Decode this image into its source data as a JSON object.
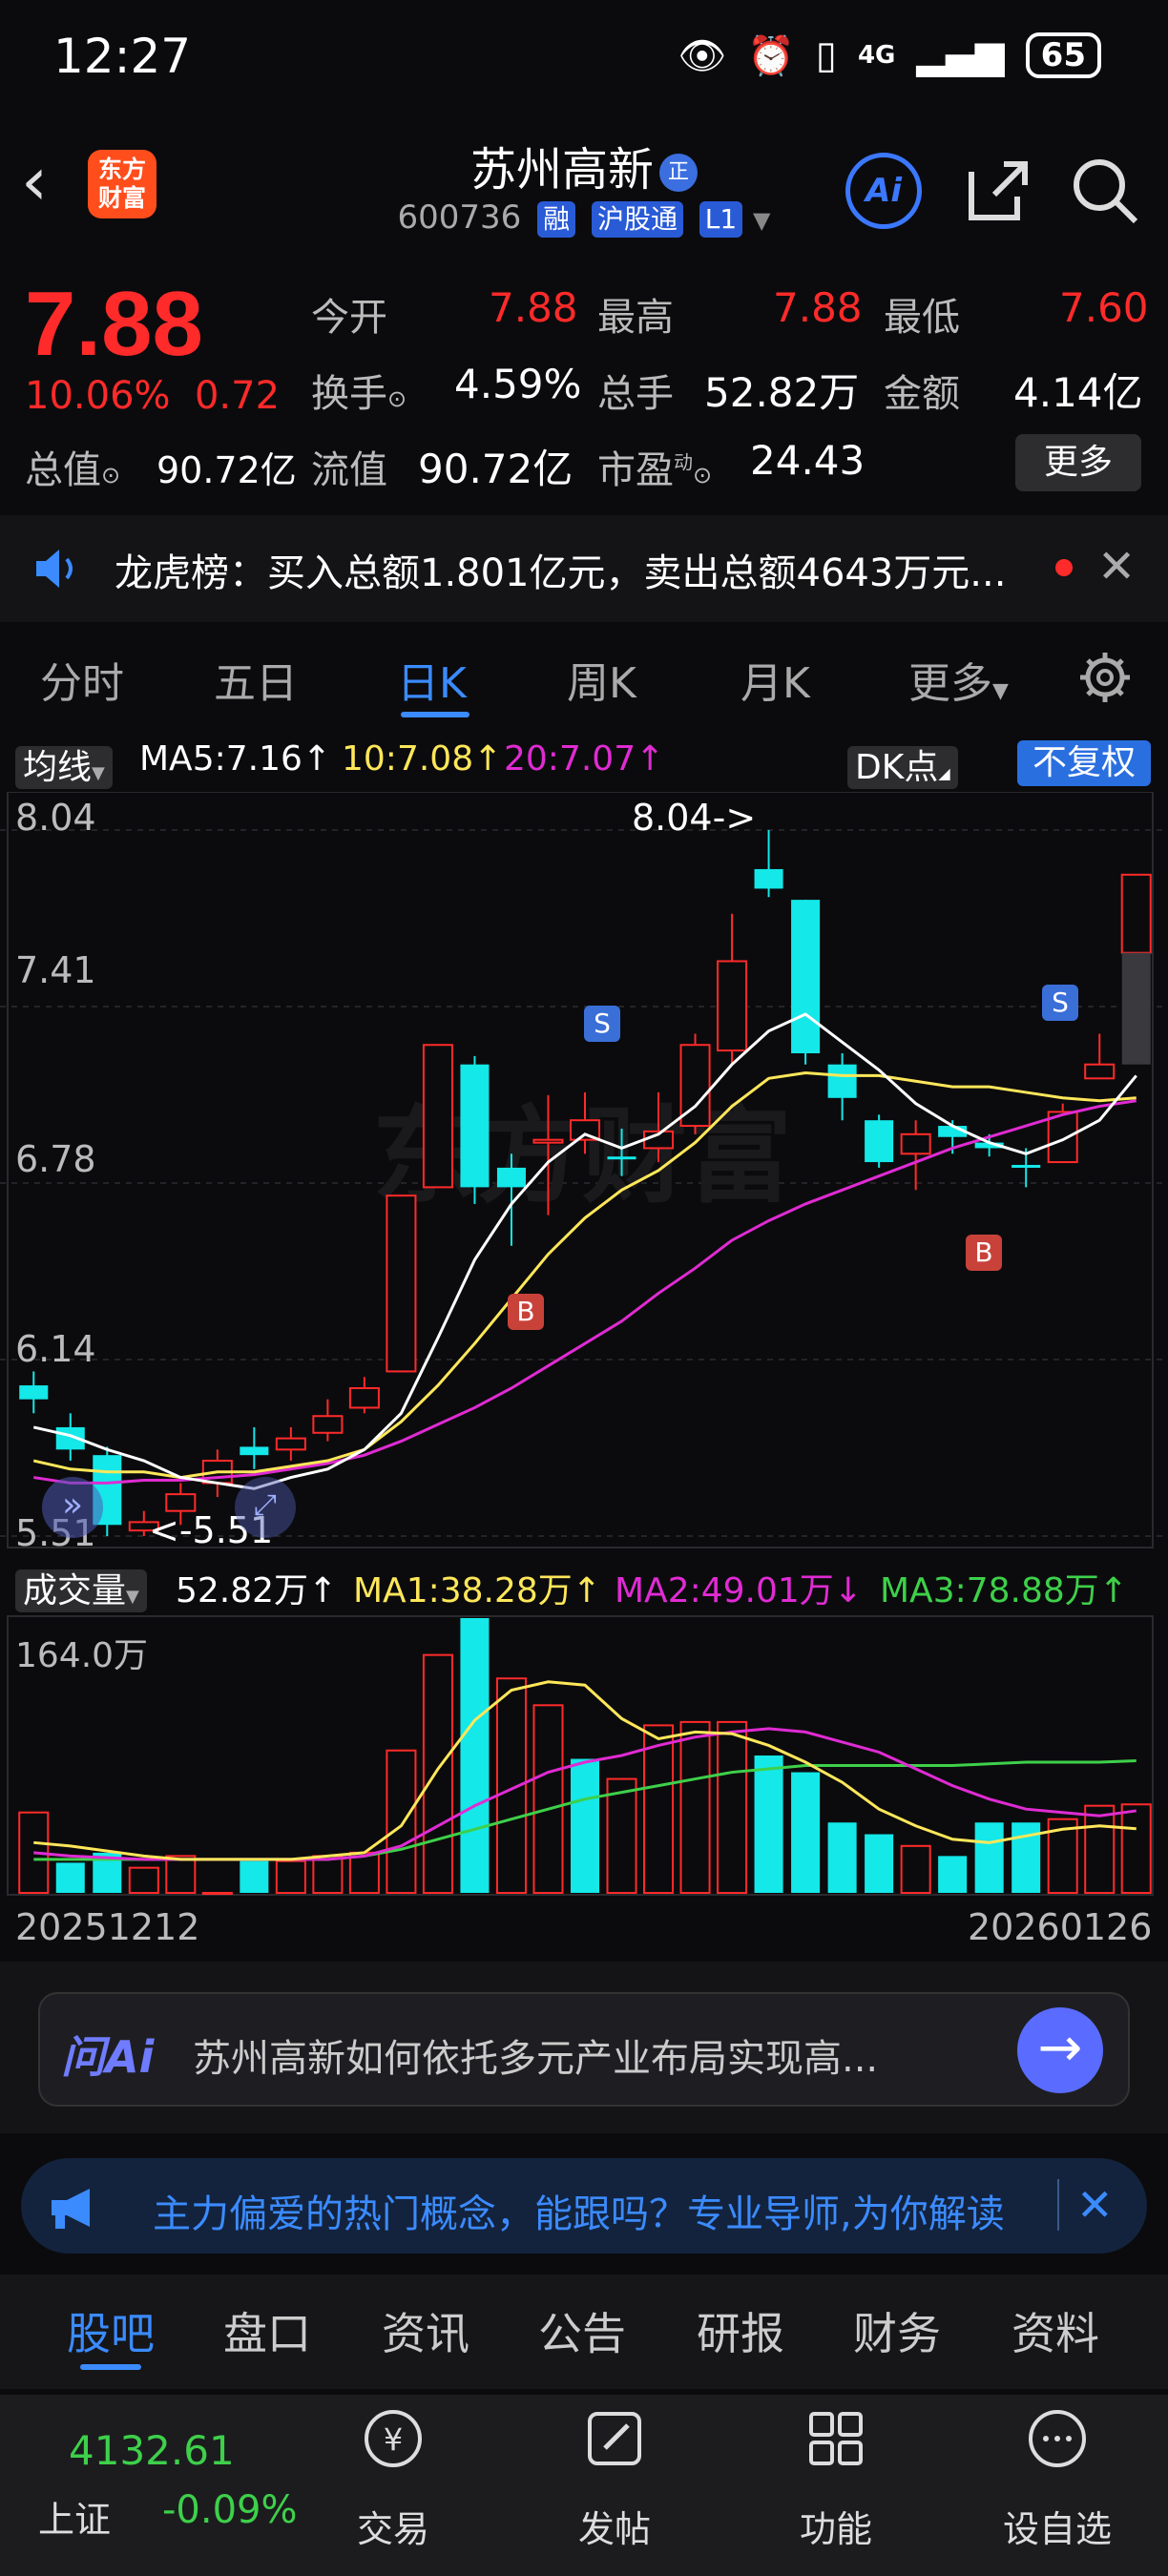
{
  "status": {
    "time": "12:27",
    "signal": "4G",
    "battery": "65"
  },
  "header": {
    "logo": "东方财富",
    "name": "苏州高新",
    "badge": "正",
    "code": "600736",
    "tags": [
      "融",
      "沪股通",
      "L1"
    ],
    "ai_label": "Ai"
  },
  "quote": {
    "price": "7.88",
    "change_pct": "10.06%",
    "change": "0.72",
    "open_label": "今开",
    "open": "7.88",
    "high_label": "最高",
    "high": "7.88",
    "low_label": "最低",
    "low": "7.60",
    "turnover_label": "换手",
    "turnover": "4.59%",
    "volume_label": "总手",
    "volume": "52.82万",
    "amount_label": "金额",
    "amount": "4.14亿",
    "mktcap_label": "总值",
    "mktcap": "90.72亿",
    "float_label": "流值",
    "float": "90.72亿",
    "pe_label": "市盈",
    "pe_sup": "动",
    "pe": "24.43",
    "more": "更多"
  },
  "notice": {
    "text": "龙虎榜：买入总额1.801亿元，卖出总额4643万元..."
  },
  "tabs": [
    "分时",
    "五日",
    "日K",
    "周K",
    "月K",
    "更多"
  ],
  "ma": {
    "selector": "均线",
    "ma5": "MA5:7.16",
    "ma10": "10:7.08",
    "ma20": "20:7.07",
    "dk": "DK点",
    "adjust": "不复权"
  },
  "price_axis": [
    "8.04",
    "7.41",
    "6.78",
    "6.14",
    "5.51"
  ],
  "annotations": {
    "high": "8.04->",
    "low": "<-5.51",
    "s": "S",
    "b": "B"
  },
  "volume_legend": {
    "selector": "成交量",
    "vol": "52.82万",
    "ma1": "MA1:38.28万",
    "ma2": "MA2:49.01万",
    "ma3": "MA3:78.88万",
    "max": "164.0万"
  },
  "dates": {
    "start": "20251212",
    "end": "20260126"
  },
  "chart_data": {
    "type": "candlestick",
    "ylim": [
      5.51,
      8.04
    ],
    "candles": [
      {
        "o": 6.0,
        "c": 6.05,
        "h": 6.1,
        "l": 5.95,
        "up": false
      },
      {
        "o": 5.9,
        "c": 5.82,
        "h": 5.95,
        "l": 5.78,
        "up": false
      },
      {
        "o": 5.8,
        "c": 5.55,
        "h": 5.83,
        "l": 5.51,
        "up": false
      },
      {
        "o": 5.53,
        "c": 5.56,
        "h": 5.6,
        "l": 5.51,
        "up": true
      },
      {
        "o": 5.6,
        "c": 5.66,
        "h": 5.7,
        "l": 5.55,
        "up": true
      },
      {
        "o": 5.7,
        "c": 5.78,
        "h": 5.82,
        "l": 5.65,
        "up": true
      },
      {
        "o": 5.8,
        "c": 5.83,
        "h": 5.9,
        "l": 5.75,
        "up": false
      },
      {
        "o": 5.82,
        "c": 5.86,
        "h": 5.9,
        "l": 5.78,
        "up": true
      },
      {
        "o": 5.88,
        "c": 5.94,
        "h": 6.0,
        "l": 5.85,
        "up": true
      },
      {
        "o": 5.97,
        "c": 6.04,
        "h": 6.08,
        "l": 5.95,
        "up": true
      },
      {
        "o": 6.1,
        "c": 6.73,
        "h": 6.73,
        "l": 6.1,
        "up": true
      },
      {
        "o": 6.76,
        "c": 7.27,
        "h": 7.27,
        "l": 6.76,
        "up": true
      },
      {
        "o": 7.2,
        "c": 6.76,
        "h": 7.23,
        "l": 6.7,
        "up": false
      },
      {
        "o": 6.83,
        "c": 6.76,
        "h": 6.88,
        "l": 6.55,
        "up": false
      },
      {
        "o": 6.93,
        "c": 6.92,
        "h": 7.09,
        "l": 6.66,
        "up": true
      },
      {
        "o": 6.93,
        "c": 7.0,
        "h": 7.1,
        "l": 6.88,
        "up": true
      },
      {
        "o": 6.87,
        "c": 6.86,
        "h": 6.97,
        "l": 6.8,
        "up": false
      },
      {
        "o": 6.9,
        "c": 6.96,
        "h": 7.1,
        "l": 6.85,
        "up": true
      },
      {
        "o": 6.98,
        "c": 7.27,
        "h": 7.31,
        "l": 6.95,
        "up": true
      },
      {
        "o": 7.25,
        "c": 7.57,
        "h": 7.74,
        "l": 7.2,
        "up": true
      },
      {
        "o": 7.9,
        "c": 7.83,
        "h": 8.04,
        "l": 7.8,
        "up": false
      },
      {
        "o": 7.79,
        "c": 7.24,
        "h": 7.79,
        "l": 7.2,
        "up": false
      },
      {
        "o": 7.2,
        "c": 7.08,
        "h": 7.24,
        "l": 7.0,
        "up": false
      },
      {
        "o": 7.0,
        "c": 6.85,
        "h": 7.02,
        "l": 6.83,
        "up": false
      },
      {
        "o": 6.95,
        "c": 6.88,
        "h": 7.0,
        "l": 6.75,
        "up": true
      },
      {
        "o": 6.98,
        "c": 6.94,
        "h": 7.0,
        "l": 6.88,
        "up": false
      },
      {
        "o": 6.92,
        "c": 6.9,
        "h": 6.95,
        "l": 6.87,
        "up": false
      },
      {
        "o": 6.84,
        "c": 6.84,
        "h": 6.9,
        "l": 6.76,
        "up": false
      },
      {
        "o": 6.85,
        "c": 7.03,
        "h": 7.06,
        "l": 6.85,
        "up": true
      },
      {
        "o": 7.15,
        "c": 7.2,
        "h": 7.31,
        "l": 7.15,
        "up": true
      },
      {
        "o": 7.6,
        "c": 7.88,
        "h": 7.88,
        "l": 7.6,
        "up": true
      }
    ],
    "ma5": [
      5.9,
      5.87,
      5.82,
      5.78,
      5.72,
      5.7,
      5.68,
      5.72,
      5.75,
      5.82,
      5.95,
      6.22,
      6.5,
      6.7,
      6.85,
      6.95,
      6.9,
      6.95,
      7.05,
      7.2,
      7.32,
      7.38,
      7.28,
      7.18,
      7.06,
      6.98,
      6.92,
      6.88,
      6.93,
      7.0,
      7.16
    ],
    "ma10": [
      5.78,
      5.75,
      5.74,
      5.74,
      5.72,
      5.74,
      5.74,
      5.76,
      5.78,
      5.82,
      5.92,
      6.05,
      6.2,
      6.36,
      6.52,
      6.65,
      6.75,
      6.82,
      6.92,
      7.05,
      7.15,
      7.17,
      7.16,
      7.16,
      7.14,
      7.12,
      7.12,
      7.1,
      7.08,
      7.07,
      7.08
    ],
    "ma20": [
      5.72,
      5.7,
      5.7,
      5.71,
      5.71,
      5.72,
      5.73,
      5.75,
      5.77,
      5.8,
      5.85,
      5.91,
      5.97,
      6.04,
      6.12,
      6.2,
      6.28,
      6.38,
      6.47,
      6.57,
      6.64,
      6.7,
      6.75,
      6.8,
      6.85,
      6.9,
      6.94,
      6.98,
      7.02,
      7.05,
      7.07
    ],
    "volume": {
      "ylim": [
        0,
        164.0
      ],
      "bars": [
        48,
        18,
        24,
        15,
        22,
        0,
        19,
        19,
        22,
        24,
        85,
        142,
        164,
        128,
        112,
        80,
        68,
        100,
        102,
        102,
        82,
        72,
        42,
        35,
        28,
        22,
        42,
        42,
        44,
        52,
        52.82
      ],
      "up": [
        true,
        false,
        false,
        true,
        true,
        true,
        false,
        true,
        true,
        true,
        true,
        true,
        false,
        true,
        true,
        false,
        true,
        true,
        true,
        true,
        false,
        false,
        false,
        false,
        true,
        false,
        false,
        false,
        true,
        true,
        true
      ],
      "ma1": [
        30,
        28,
        25,
        22,
        20,
        20,
        20,
        20,
        22,
        24,
        40,
        74,
        103,
        121,
        126,
        124,
        104,
        92,
        96,
        95,
        88,
        78,
        66,
        50,
        40,
        32,
        30,
        34,
        38,
        40,
        38.28
      ],
      "ma2": [
        24,
        22,
        21,
        20,
        20,
        20,
        20,
        20,
        20,
        22,
        28,
        40,
        52,
        62,
        72,
        78,
        82,
        88,
        93,
        96,
        98,
        96,
        90,
        84,
        74,
        64,
        56,
        50,
        48,
        46,
        49.01
      ],
      "ma3": [
        20,
        20,
        20,
        20,
        20,
        20,
        20,
        20,
        20,
        22,
        26,
        32,
        38,
        44,
        50,
        56,
        60,
        64,
        68,
        72,
        74,
        76,
        76,
        76,
        76,
        76,
        77,
        78,
        78,
        78,
        78.88
      ]
    }
  },
  "ai_bar": {
    "label": "问Ai",
    "text": "苏州高新如何依托多元产业布局实现高..."
  },
  "promo": {
    "text": "主力偏爱的热门概念，能跟吗？专业导师,为你解读"
  },
  "bottom_tabs": [
    "股吧",
    "盘口",
    "资讯",
    "公告",
    "研报",
    "财务",
    "资料"
  ],
  "bottom_nav": {
    "index_value": "4132.61",
    "index_name": "上证",
    "index_change": "-0.09%",
    "items": [
      "交易",
      "发帖",
      "功能",
      "设自选"
    ]
  }
}
